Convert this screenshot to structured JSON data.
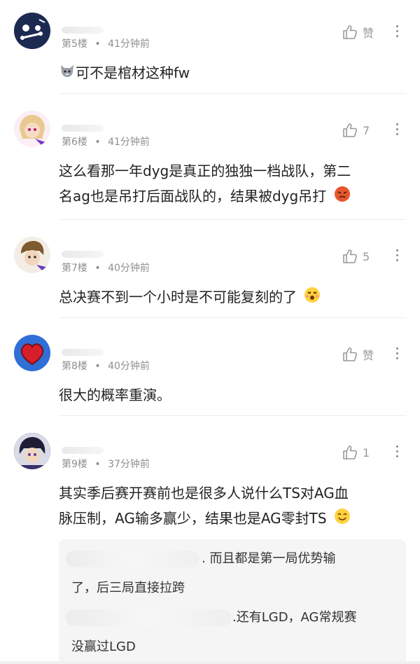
{
  "comments": [
    {
      "floor": "第5楼",
      "sep": "•",
      "time": "41分钟前",
      "likes": "赞",
      "text": "可不是棺材这种fw",
      "avatar_colors": [
        "#1c2a52",
        "#ffffff"
      ]
    },
    {
      "floor": "第6楼",
      "sep": "•",
      "time": "41分钟前",
      "likes": "7",
      "text_line1": "这么看那一年dyg是真正的独独一档战队，第二",
      "text_line2": "名ag也是吊打后面战队的，结果被dyg吊打",
      "avatar_colors": [
        "#f3d6b3",
        "#7a3cc2"
      ]
    },
    {
      "floor": "第7楼",
      "sep": "•",
      "time": "40分钟前",
      "likes": "5",
      "text": "总决赛不到一个小时是不可能复刻的了",
      "avatar_colors": [
        "#7e5a2e",
        "#6a3fb8"
      ]
    },
    {
      "floor": "第8楼",
      "sep": "•",
      "time": "40分钟前",
      "likes": "赞",
      "text": "很大的概率重演。",
      "avatar_colors": [
        "#2f6fd6",
        "#d61f2a"
      ]
    },
    {
      "floor": "第9楼",
      "sep": "•",
      "time": "37分钟前",
      "likes": "1",
      "text_line1": "其实季后赛开赛前也是很多人说什么TS对AG血",
      "text_line2": "脉压制，AG输多赢少，结果也是AG零封TS",
      "avatar_colors": [
        "#2b2a4a",
        "#f2d7c0"
      ]
    }
  ],
  "reply": {
    "line1": ". 而且都是第一局优势输",
    "line2": "了，后三局直接拉跨",
    "line3": ".还有LGD，AG常规赛",
    "line4": "没赢过LGD"
  },
  "icons": {
    "like": "thumbs-up-icon",
    "more": "more-vertical-icon"
  },
  "colors": {
    "meta": "#8f8f8f",
    "divider": "#ededed",
    "reply_bg": "#f5f5f5"
  }
}
